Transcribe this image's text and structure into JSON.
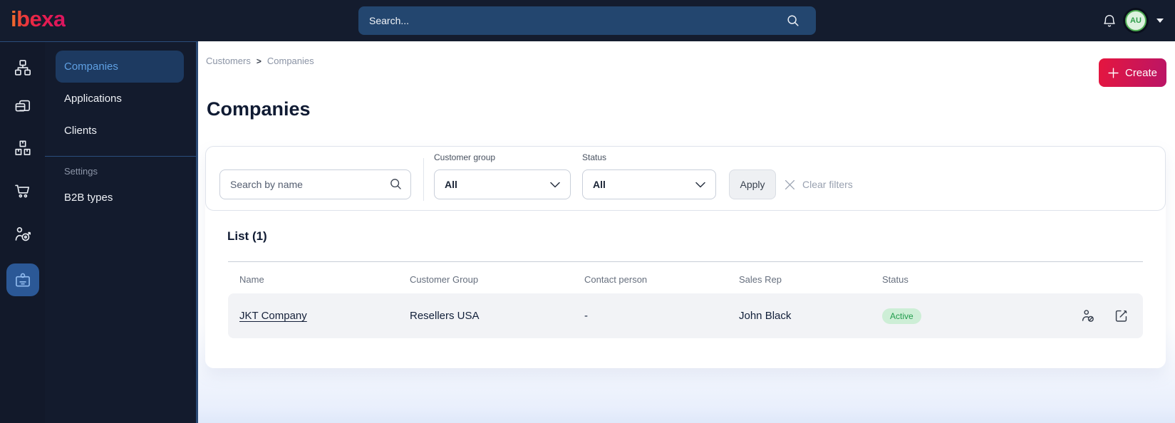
{
  "topbar": {
    "logo_text": "ibexa",
    "search_placeholder": "Search...",
    "avatar_initials": "AU"
  },
  "icon_rail": {
    "items": [
      {
        "icon": "content-tree-icon",
        "active": false
      },
      {
        "icon": "pages-icon",
        "active": false
      },
      {
        "icon": "product-catalog-icon",
        "active": false
      },
      {
        "icon": "commerce-cart-icon",
        "active": false
      },
      {
        "icon": "personalization-target-icon",
        "active": false
      },
      {
        "icon": "customer-badge-icon",
        "active": true
      }
    ]
  },
  "sidebar": {
    "items": [
      {
        "label": "Companies",
        "active": true
      },
      {
        "label": "Applications",
        "active": false
      },
      {
        "label": "Clients",
        "active": false
      }
    ],
    "section_label": "Settings",
    "settings_items": [
      {
        "label": "B2B types"
      }
    ]
  },
  "breadcrumb": {
    "items": [
      "Customers",
      "Companies"
    ],
    "separator": ">"
  },
  "page": {
    "title": "Companies",
    "create_label": "Create"
  },
  "filters": {
    "search_placeholder": "Search by name",
    "customer_group": {
      "label": "Customer group",
      "value": "All"
    },
    "status": {
      "label": "Status",
      "value": "All"
    },
    "apply_label": "Apply",
    "clear_label": "Clear filters"
  },
  "list": {
    "title": "List (1)",
    "columns": [
      "Name",
      "Customer Group",
      "Contact person",
      "Sales Rep",
      "Status"
    ],
    "rows": [
      {
        "name": "JKT Company",
        "customer_group": "Resellers USA",
        "contact_person": "-",
        "sales_rep": "John Black",
        "status": "Active"
      }
    ],
    "row_actions": [
      "user-block-icon",
      "edit-icon"
    ]
  },
  "colors": {
    "accent": "#e0154a",
    "topbar_bg": "#141c2e",
    "active_nav_bg": "#1d3a61",
    "active_nav_text": "#5fa0e3",
    "active_rail_bg": "#2b5896",
    "status_active_bg": "#cdeed6",
    "status_active_text": "#219c4c"
  }
}
